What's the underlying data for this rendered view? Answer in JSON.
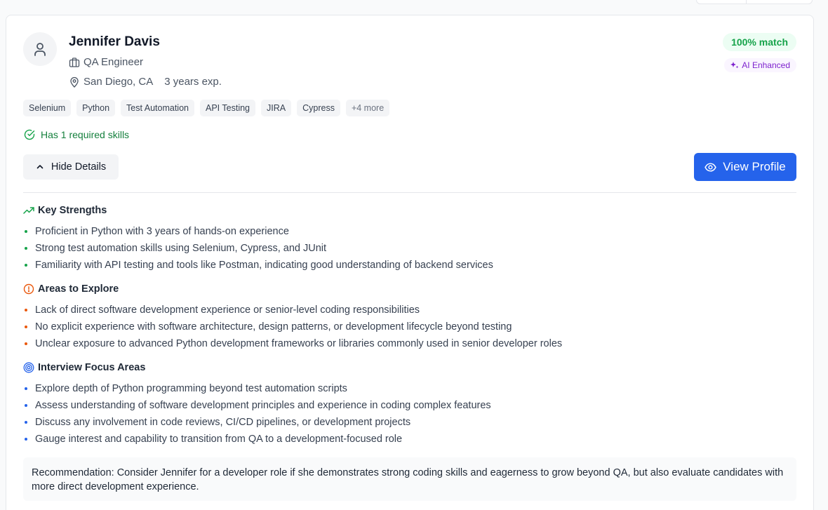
{
  "candidate": {
    "name": "Jennifer Davis",
    "role": "QA Engineer",
    "location": "San Diego, CA",
    "experience": "3 years exp.",
    "match": "100% match",
    "ai_badge": "AI Enhanced",
    "skills": [
      "Selenium",
      "Python",
      "Test Automation",
      "API Testing",
      "JIRA",
      "Cypress"
    ],
    "more_skills": "+4 more",
    "required_skills_note": "Has 1 required skills"
  },
  "actions": {
    "hide_details": "Hide Details",
    "view_profile": "View Profile"
  },
  "strengths": {
    "title": "Key Strengths",
    "items": [
      "Proficient in Python with 3 years of hands-on experience",
      "Strong test automation skills using Selenium, Cypress, and JUnit",
      "Familiarity with API testing and tools like Postman, indicating good understanding of backend services"
    ]
  },
  "explore": {
    "title": "Areas to Explore",
    "items": [
      "Lack of direct software development experience or senior-level coding responsibilities",
      "No explicit experience with software architecture, design patterns, or development lifecycle beyond testing",
      "Unclear exposure to advanced Python development frameworks or libraries commonly used in senior developer roles"
    ]
  },
  "focus": {
    "title": "Interview Focus Areas",
    "items": [
      "Explore depth of Python programming beyond test automation scripts",
      "Assess understanding of software development principles and experience in coding complex features",
      "Discuss any involvement in code reviews, CI/CD pipelines, or development projects",
      "Gauge interest and capability to transition from QA to a development-focused role"
    ]
  },
  "recommendation": "Recommendation: Consider Jennifer for a developer role if she demonstrates strong coding skills and eagerness to grow beyond QA, but also evaluate candidates with more direct development experience.",
  "colors": {
    "accent": "#2563eb",
    "success": "#16a34a",
    "warning": "#ea580c",
    "ai": "#7e22ce"
  }
}
